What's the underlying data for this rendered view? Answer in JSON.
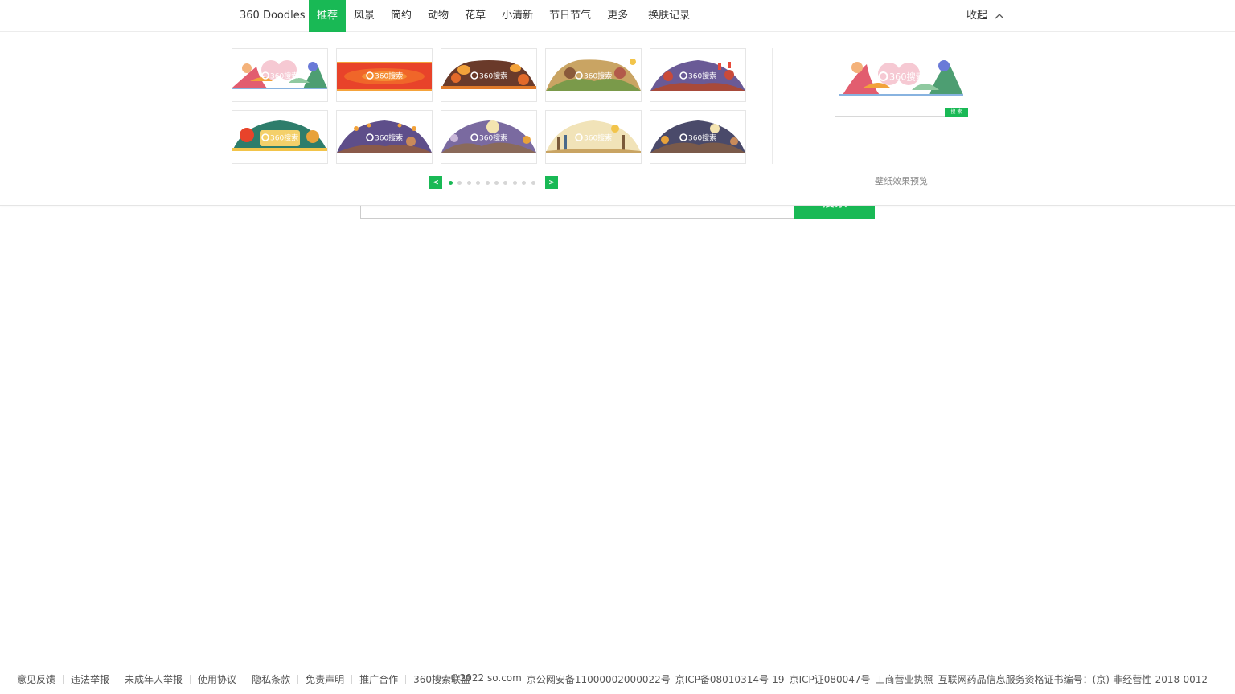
{
  "nav": {
    "brand": "360 Doodles",
    "tabs": [
      {
        "label": "推荐",
        "active": true
      },
      {
        "label": "风景",
        "active": false
      },
      {
        "label": "简约",
        "active": false
      },
      {
        "label": "动物",
        "active": false
      },
      {
        "label": "花草",
        "active": false
      },
      {
        "label": "小清新",
        "active": false
      },
      {
        "label": "节日节气",
        "active": false
      },
      {
        "label": "更多",
        "active": false
      }
    ],
    "history": "换肤记录",
    "collapse": "收起"
  },
  "skins": {
    "logo_text": "360搜索",
    "thumbnails": [
      {
        "theme": "festival-people-colorful",
        "accent": "#f4a9b8"
      },
      {
        "theme": "red-orange-banner",
        "accent": "#e8432a"
      },
      {
        "theme": "lanterns-orange",
        "accent": "#e07a2a"
      },
      {
        "theme": "couple-green-hills",
        "accent": "#7a9a4a"
      },
      {
        "theme": "dusk-family-red",
        "accent": "#7a4a8a"
      },
      {
        "theme": "new-year-teal",
        "accent": "#2e7d6b"
      },
      {
        "theme": "lantern-night-purple",
        "accent": "#6a5a9a"
      },
      {
        "theme": "mid-autumn-moon",
        "accent": "#7a6aa0"
      },
      {
        "theme": "cream-family-walk",
        "accent": "#e8d9a8"
      },
      {
        "theme": "moon-night-gold",
        "accent": "#4a4a6a"
      }
    ],
    "pager": {
      "prev": "<",
      "next": ">",
      "page_count": 10,
      "current": 1
    }
  },
  "preview": {
    "search_button": "搜 索",
    "caption": "壁纸效果预览"
  },
  "search": {
    "button": "搜索"
  },
  "footer": {
    "links": [
      "意见反馈",
      "违法举报",
      "未成年人举报",
      "使用协议",
      "隐私条款",
      "免责声明",
      "推广合作",
      "360搜索联盟"
    ],
    "legal": [
      "©2022 so.com",
      "京公网安备11000002000022号",
      "京ICP备08010314号-19",
      "京ICP证080047号",
      "工商营业执照",
      "互联网药品信息服务资格证书编号：(京)-非经营性-2018-0012"
    ]
  },
  "colors": {
    "brand_green": "#19b955",
    "border": "#e6e6e6",
    "text": "#333333",
    "muted": "#888888"
  }
}
